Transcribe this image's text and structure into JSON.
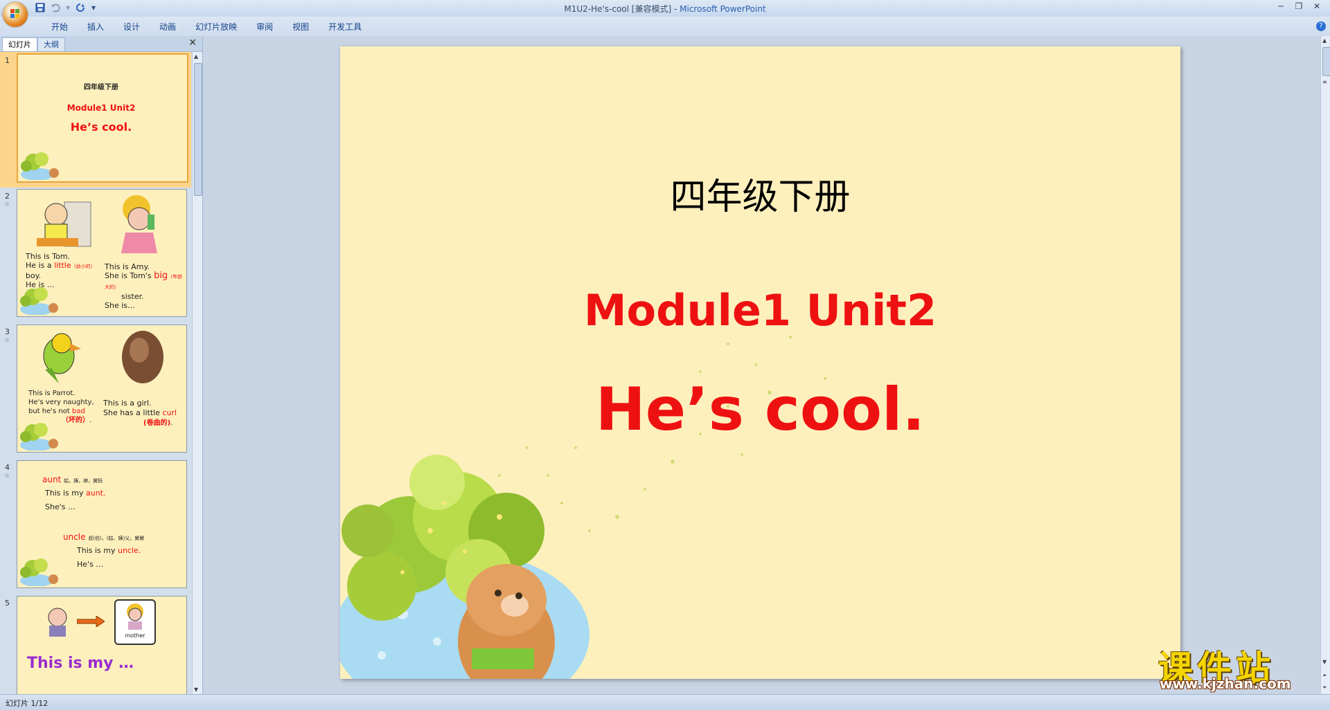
{
  "window": {
    "doc_title": "M1U2-He's-cool [兼容模式]",
    "separator": " - ",
    "app_name": "Microsoft PowerPoint"
  },
  "ribbon": {
    "tabs": [
      "开始",
      "插入",
      "设计",
      "动画",
      "幻灯片放映",
      "审阅",
      "视图",
      "开发工具"
    ]
  },
  "pane": {
    "tab_slides": "幻灯片",
    "tab_outline": "大纲"
  },
  "thumbnails": [
    {
      "num": "1",
      "title": "四年级下册",
      "sub": "Module1 Unit2",
      "main": "He’s  cool."
    },
    {
      "num": "2",
      "left_lines": [
        "This is Tom.",
        "He is a ",
        "little",
        "（幼小的）",
        "boy.",
        "He is …"
      ],
      "right_lines": [
        "This is Amy.",
        "She is Tom's ",
        "big",
        "（年龄大的）",
        "sister.",
        "She is…"
      ]
    },
    {
      "num": "3",
      "left_lines": [
        "This is Parrot.",
        "He's very naughty,",
        "but he's not ",
        "bad",
        "（坏的）",
        "."
      ],
      "right_lines": [
        "This is a girl.",
        "She has a little ",
        "curl",
        "(卷曲的)",
        "."
      ]
    },
    {
      "num": "4",
      "w1": "aunt",
      "w1_def": "姑，姨，婶，舅妈",
      "l1": "This is my ",
      "l1_red": "aunt.",
      "l2": "She's …",
      "w2": "uncle",
      "w2_def": "叔(伯)，(姑、姨)父，舅舅",
      "l3": "This is my ",
      "l3_red": "uncle.",
      "l4": "He's …"
    },
    {
      "num": "5",
      "label": "mother",
      "big": "This  is  my  …"
    }
  ],
  "slide": {
    "title": "四年级下册",
    "subtitle": "Module1  Unit2",
    "main": "He’s  cool."
  },
  "status": {
    "text": "幻灯片 1/12"
  },
  "watermark": {
    "cn": "课件站",
    "url": "www.kjzhan.com"
  },
  "colors": {
    "slide_bg": "#fef0bd",
    "accent_red": "#ee1111",
    "ribbon_blue": "#15428b"
  }
}
